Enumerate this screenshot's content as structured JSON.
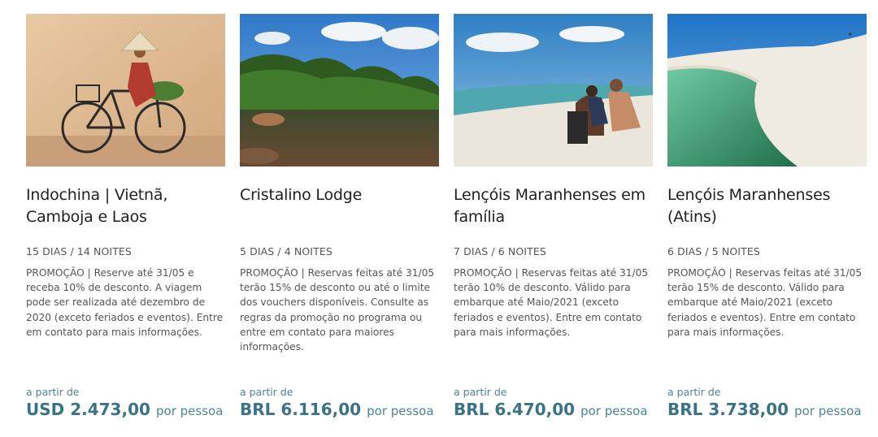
{
  "cards": [
    {
      "title": "Indochina | Vietnã, Camboja e Laos",
      "image": "woman-riding-bicycle-photo",
      "duration": "15 DIAS / 14 NOITES",
      "description": "PROMOÇÃO | Reserve até 31/05 e receba 10% de desconto. A viagem pode ser realizada até dezembro de 2020 (exceto feriados e eventos). Entre em contato para mais informações.",
      "from_label": "a partir de",
      "price": "USD 2.473,00",
      "per_person": "por pessoa"
    },
    {
      "title": "Cristalino Lodge",
      "image": "jungle-river-photo",
      "duration": "5 DIAS / 4 NOITES",
      "description": "PROMOÇÃO | Reservas feitas até 31/05 terão 15% de desconto ou até o limite dos vouchers disponíveis. Consulte as regras da promoção no programa ou entre em contato para maiores informações.",
      "from_label": "a partir de",
      "price": "BRL 6.116,00",
      "per_person": "por pessoa"
    },
    {
      "title": "Lençóis Maranhenses em família",
      "image": "family-on-dunes-photo",
      "duration": "7 DIAS / 6 NOITES",
      "description": "PROMOÇÃO | Reservas feitas até 31/05 terão 10% de desconto. Válido para embarque até Maio/2021 (exceto feriados e eventos). Entre em contato para mais informações.",
      "from_label": "a partir de",
      "price": "BRL 6.470,00",
      "per_person": "por pessoa"
    },
    {
      "title": "Lençóis Maranhenses (Atins)",
      "image": "dune-lagoon-photo",
      "duration": "6 DIAS / 5 NOITES",
      "description": "PROMOÇÃO | Reservas feitas até 31/05 terão 15% de desconto. Válido para embarque até Maio/2021 (exceto feriados e eventos). Entre em contato para mais informações.",
      "from_label": "a partir de",
      "price": "BRL 3.738,00",
      "per_person": "por pessoa"
    }
  ],
  "colors": {
    "price": "#3b7386",
    "text": "#555555",
    "title": "#1f1f1f"
  }
}
